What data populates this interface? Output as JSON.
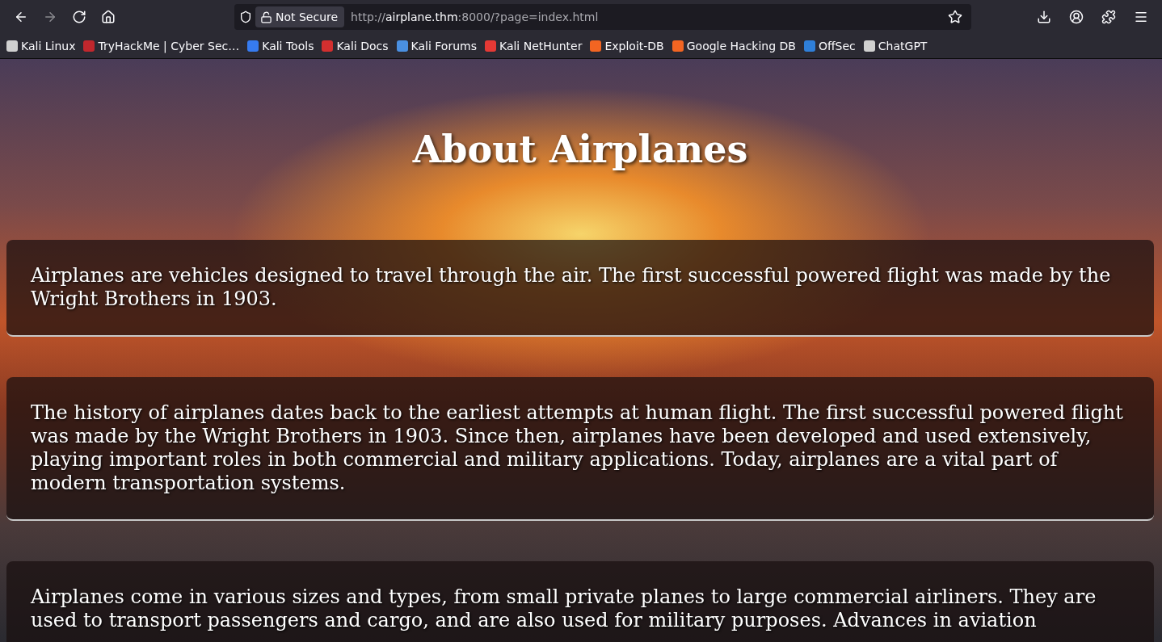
{
  "browser": {
    "security_label": "Not Secure",
    "url": {
      "scheme": "http://",
      "host": "airplane.thm",
      "rest": ":8000/?page=index.html"
    },
    "bookmarks": [
      {
        "label": "Kali Linux",
        "color": "#d0d0d0"
      },
      {
        "label": "TryHackMe | Cyber Sec…",
        "color": "#c1272d"
      },
      {
        "label": "Kali Tools",
        "color": "#367bf0"
      },
      {
        "label": "Kali Docs",
        "color": "#d32f2f"
      },
      {
        "label": "Kali Forums",
        "color": "#4a90e2"
      },
      {
        "label": "Kali NetHunter",
        "color": "#e53935"
      },
      {
        "label": "Exploit-DB",
        "color": "#f26522"
      },
      {
        "label": "Google Hacking DB",
        "color": "#f26522"
      },
      {
        "label": "OffSec",
        "color": "#2f7fd8"
      },
      {
        "label": "ChatGPT",
        "color": "#d0d0d0"
      }
    ]
  },
  "page": {
    "title": "About Airplanes",
    "paragraphs": [
      "Airplanes are vehicles designed to travel through the air. The first successful powered flight was made by the Wright Brothers in 1903.",
      "The history of airplanes dates back to the earliest attempts at human flight. The first successful powered flight was made by the Wright Brothers in 1903. Since then, airplanes have been developed and used extensively, playing important roles in both commercial and military applications. Today, airplanes are a vital part of modern transportation systems.",
      "Airplanes come in various sizes and types, from small private planes to large commercial airliners. They are used to transport passengers and cargo, and are also used for military purposes. Advances in aviation"
    ]
  }
}
